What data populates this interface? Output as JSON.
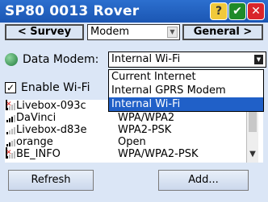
{
  "window": {
    "title": "SP80 0013 Rover",
    "help_glyph": "?",
    "ok_glyph": "✔",
    "close_glyph": "✕"
  },
  "nav": {
    "back_label": "< Survey",
    "section_value": "Modem",
    "next_label": "General >"
  },
  "modem": {
    "label": "Data Modem:",
    "selected": "Internal Wi-Fi",
    "options": [
      "Current Internet",
      "Internal GPRS Modem",
      "Internal Wi-Fi"
    ]
  },
  "enable_wifi": {
    "label": "Enable Wi-Fi",
    "checked": true
  },
  "networks": [
    {
      "name": "Livebox-093c",
      "security": "",
      "signal": 1,
      "error": true
    },
    {
      "name": "DaVinci",
      "security": "WPA/WPA2",
      "signal": 3,
      "error": false
    },
    {
      "name": "Livebox-d83e",
      "security": "WPA2-PSK",
      "signal": 1,
      "error": false
    },
    {
      "name": "orange",
      "security": "Open",
      "signal": 2,
      "error": false
    },
    {
      "name": "BE_INFO",
      "security": "WPA/WPA2-PSK",
      "signal": 1,
      "error": true
    }
  ],
  "buttons": {
    "refresh": "Refresh",
    "add": "Add..."
  },
  "colors": {
    "titlebar": "#1b56b3",
    "selection": "#2060c8",
    "background": "#dbe6f6"
  }
}
